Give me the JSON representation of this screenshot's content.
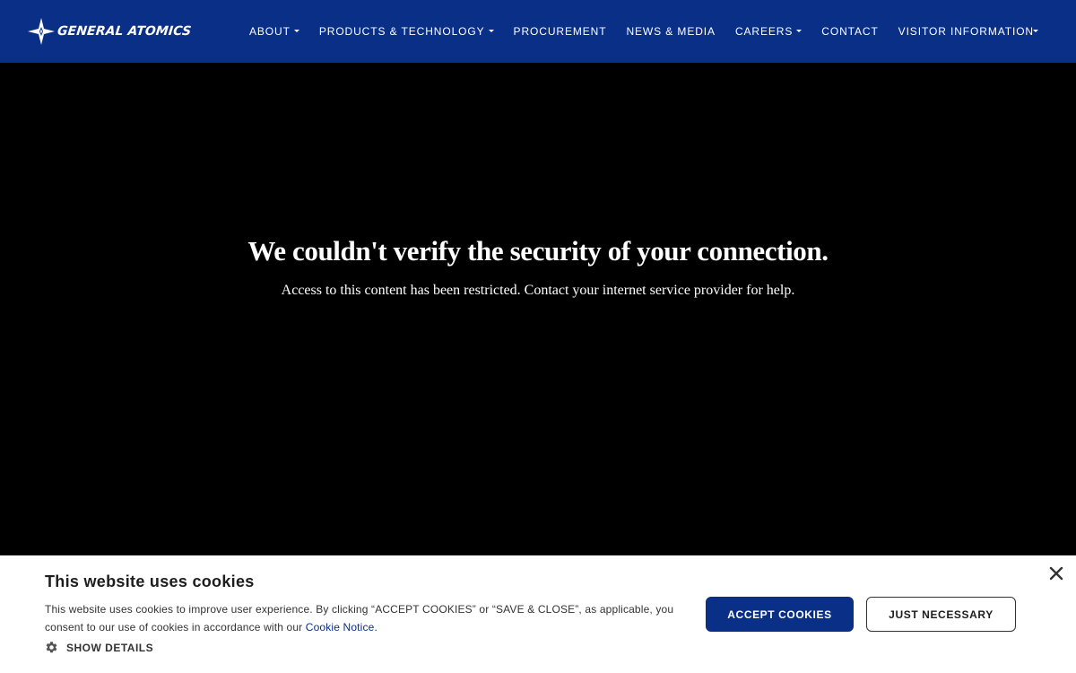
{
  "colors": {
    "navbar_background": "#0a2f86",
    "page_background": "#000000",
    "banner_background": "#ffffff",
    "accept_button": "#0a2f86",
    "link": "#0a2f86"
  },
  "header": {
    "brand": {
      "name": "GENERAL ATOMICS",
      "icon": "general-atomics-logo-icon"
    },
    "nav": [
      {
        "label": "ABOUT",
        "has_dropdown": true
      },
      {
        "label": "PRODUCTS & TECHNOLOGY",
        "has_dropdown": true
      },
      {
        "label": "PROCUREMENT",
        "has_dropdown": false
      },
      {
        "label": "NEWS & MEDIA",
        "has_dropdown": false
      },
      {
        "label": "CAREERS",
        "has_dropdown": true
      },
      {
        "label": "CONTACT",
        "has_dropdown": false
      },
      {
        "label": "VISITOR INFORMATION",
        "has_dropdown": false
      }
    ],
    "extra_dropdown_icon": "caret-down-icon"
  },
  "main": {
    "title": "We couldn't verify the security of your connection.",
    "body": "Access to this content has been restricted. Contact your internet service provider for help."
  },
  "cookie_banner": {
    "title": "This website uses cookies",
    "text_before_link": "This website uses cookies to improve user experience. By clicking “ACCEPT COOKIES” or “SAVE & CLOSE”, as applicable, you consent to our use of cookies in accordance with our ",
    "link_text": "Cookie Notice",
    "text_after_link": ".",
    "show_details_label": "SHOW DETAILS",
    "show_details_icon": "gear-icon",
    "accept_label": "ACCEPT COOKIES",
    "necessary_label": "JUST NECESSARY",
    "close_icon": "close-icon"
  }
}
